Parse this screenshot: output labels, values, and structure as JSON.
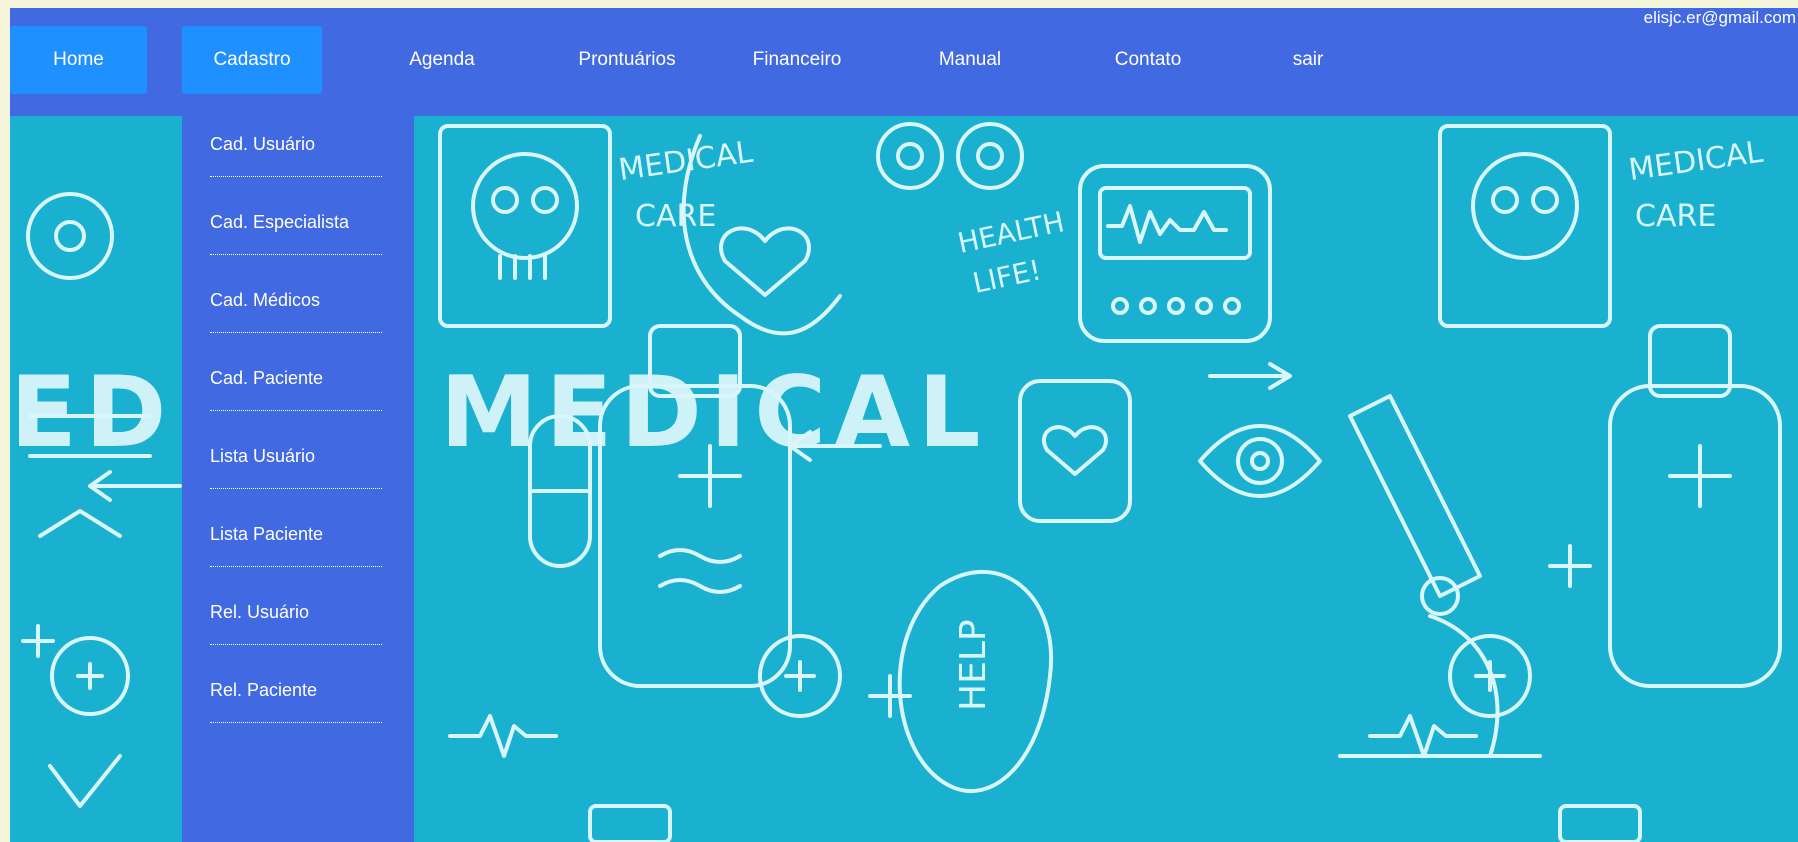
{
  "header": {
    "user_email": "elisjc.er@gmail.com"
  },
  "nav": {
    "items": [
      {
        "label": "Home"
      },
      {
        "label": "Cadastro"
      },
      {
        "label": "Agenda"
      },
      {
        "label": "Prontuários"
      },
      {
        "label": "Financeiro"
      },
      {
        "label": "Manual"
      },
      {
        "label": "Contato"
      },
      {
        "label": "sair"
      }
    ],
    "active": "Cadastro"
  },
  "dropdown": {
    "parent": "Cadastro",
    "items": [
      {
        "label": "Cad. Usuário"
      },
      {
        "label": "Cad. Especialista"
      },
      {
        "label": "Cad. Médicos"
      },
      {
        "label": "Cad. Paciente"
      },
      {
        "label": "Lista Usuário"
      },
      {
        "label": "Lista Paciente"
      },
      {
        "label": "Rel. Usuário"
      },
      {
        "label": "Rel. Paciente"
      }
    ]
  },
  "hero": {
    "banner_text": [
      "MEDICAL",
      "CARE",
      "HEALTH",
      "LIFE!",
      "HELP"
    ]
  },
  "colors": {
    "navbar": "#4169e1",
    "nav_button": "#1e90ff",
    "dropdown": "#4169e1",
    "hero_background": "#1ab0cf",
    "doodle_line": "#d8f6fb",
    "text": "#ffffff"
  },
  "icons": [
    "skull-icon",
    "bottle-icon",
    "heart-icon",
    "plus-icon",
    "pill-icon",
    "eye-icon",
    "monitor-icon",
    "microscope-icon"
  ]
}
